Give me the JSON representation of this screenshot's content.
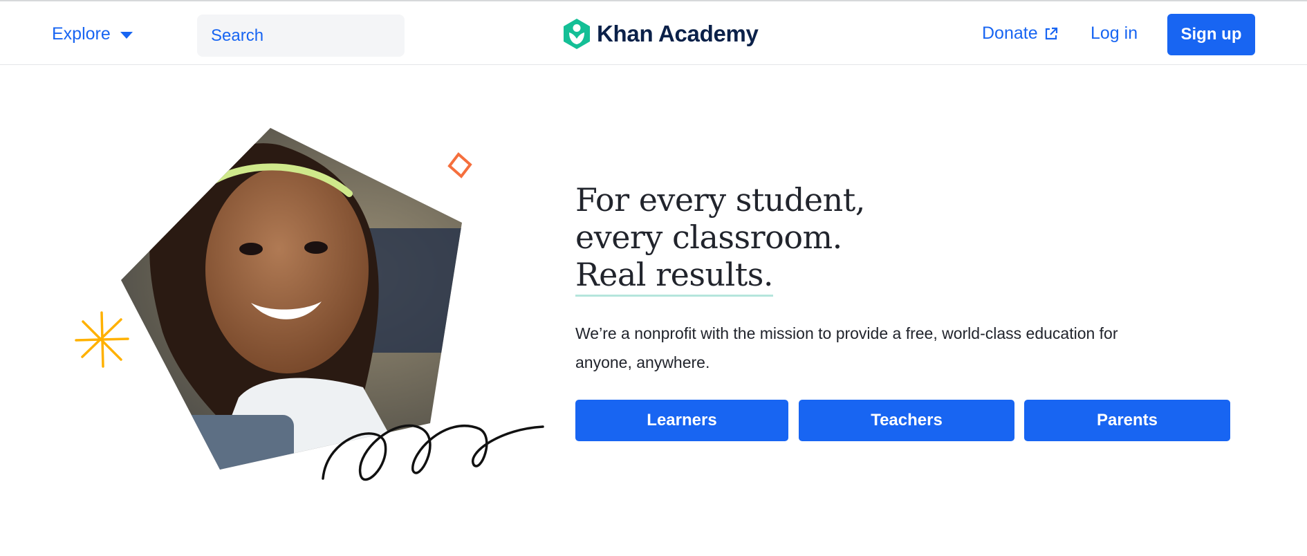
{
  "header": {
    "explore_label": "Explore",
    "search_placeholder": "Search",
    "logo_text": "Khan Academy",
    "donate_label": "Donate",
    "login_label": "Log in",
    "signup_label": "Sign up"
  },
  "hero": {
    "headline_line1": "For every student,",
    "headline_line2": "every classroom.",
    "headline_line3": "Real results.",
    "description": "We’re a nonprofit with the mission to provide a free, world-class education for anyone, anywhere.",
    "cta_learners": "Learners",
    "cta_teachers": "Teachers",
    "cta_parents": "Parents"
  },
  "icons": {
    "explore_caret": "chevron-down-icon",
    "search": "search-icon",
    "logo": "khan-academy-logo-icon",
    "external": "external-link-icon"
  },
  "colors": {
    "brand_blue": "#1865f2",
    "logo_green": "#14bf96",
    "navy": "#0b2149",
    "underline_teal": "#b5e5dc",
    "spark_yellow": "#ffb100",
    "diamond_orange": "#f56f3d"
  }
}
